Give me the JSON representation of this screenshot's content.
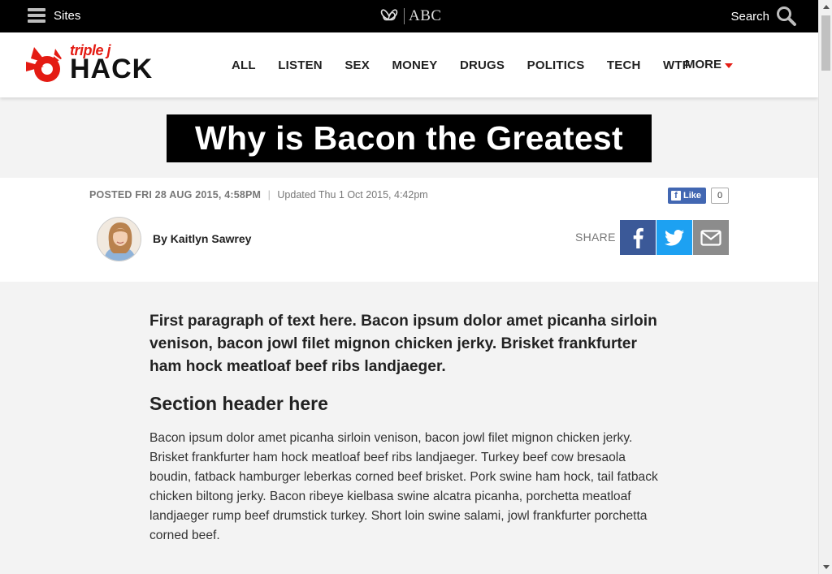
{
  "abc_bar": {
    "sites_label": "Sites",
    "logo_text": "ABC",
    "search_label": "Search"
  },
  "brand": {
    "small": "triple j",
    "large": "HACK"
  },
  "nav": {
    "items": [
      "ALL",
      "LISTEN",
      "SEX",
      "MONEY",
      "DRUGS",
      "POLITICS",
      "TECH",
      "WTF"
    ],
    "more_label": "MORE"
  },
  "article": {
    "title": "Why is Bacon the Greatest",
    "posted": "POSTED FRI 28 AUG 2015, 4:58PM",
    "separator": "|",
    "updated": "Updated Thu 1 Oct 2015, 4:42pm",
    "byline": "By Kaitlyn Sawrey",
    "lead": "First paragraph of text here. Bacon ipsum dolor amet picanha sirloin venison, bacon jowl filet mignon chicken jerky. Brisket frankfurter ham hock meatloaf beef ribs landjaeger.",
    "section_header": "Section header here",
    "body": "Bacon ipsum dolor amet picanha sirloin venison, bacon jowl filet mignon chicken jerky. Brisket frankfurter ham hock meatloaf beef ribs landjaeger. Turkey beef cow bresaola boudin, fatback hamburger leberkas corned beef brisket. Pork swine ham hock, tail fatback chicken biltong jerky. Bacon ribeye kielbasa swine alcatra picanha, porchetta meatloaf landjaeger rump beef drumstick turkey. Short loin swine salami, jowl frankfurter porchetta corned beef."
  },
  "facebook_like": {
    "label": "Like",
    "count": "0"
  },
  "share": {
    "label": "SHARE",
    "icons": [
      "facebook-icon",
      "twitter-icon",
      "email-icon"
    ]
  },
  "colors": {
    "accent": "#e41b13",
    "facebook": "#3b5998",
    "twitter": "#1da1f2",
    "email": "#8c8c8c"
  }
}
